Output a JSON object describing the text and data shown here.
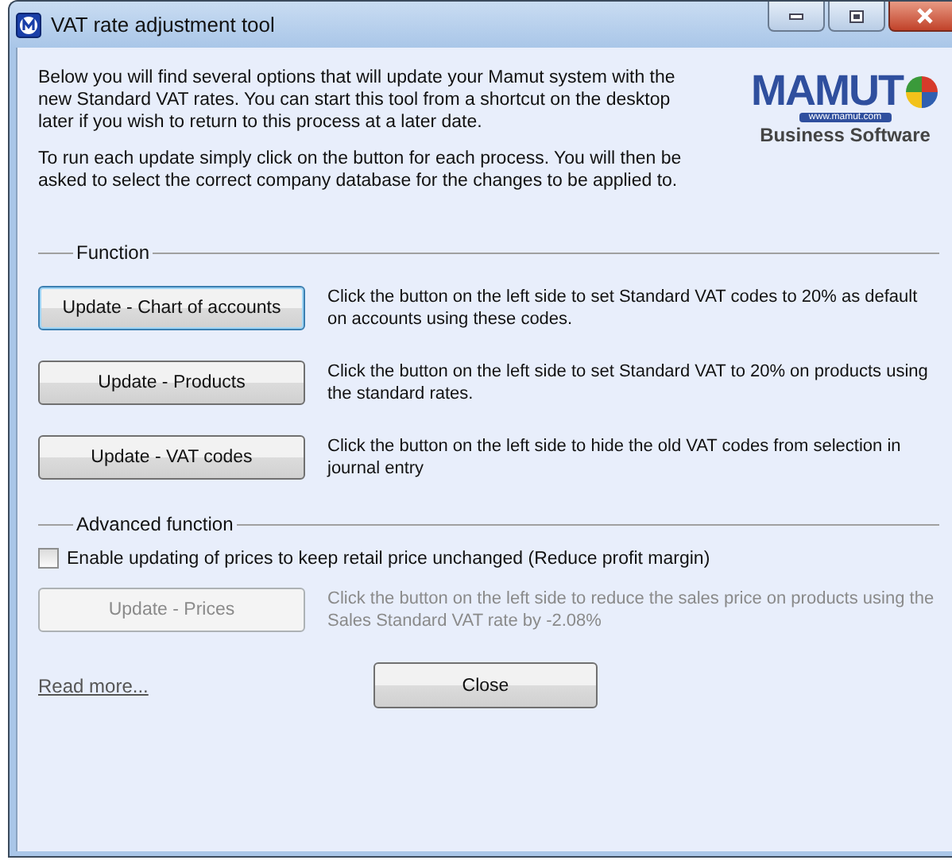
{
  "window": {
    "title": "VAT rate adjustment tool"
  },
  "logo": {
    "wordmark": "MAMUT",
    "url": "www.mamut.com",
    "tagline": "Business Software"
  },
  "intro": [
    "Below you will find several options that will update your Mamut system with the new Standard VAT rates. You can start this tool from a shortcut on the desktop later if you wish to return to this process at a later date.",
    "To run each update simply click on the button for each process. You will then be asked to select the correct company database for the changes to be applied to."
  ],
  "function": {
    "legend": "Function",
    "rows": [
      {
        "button": "Update - Chart of accounts",
        "focused": true,
        "disabled": false,
        "description": "Click the button on the left side to set Standard  VAT codes to 20% as default on accounts using these codes."
      },
      {
        "button": "Update - Products",
        "focused": false,
        "disabled": false,
        "description": "Click the button on the left side to set Standard  VAT to 20% on products using the standard rates."
      },
      {
        "button": "Update - VAT codes",
        "focused": false,
        "disabled": false,
        "description": "Click the button on the left side to hide the old VAT codes from selection in journal entry"
      }
    ]
  },
  "advanced": {
    "legend": "Advanced function",
    "checkbox": {
      "label": "Enable updating of prices to keep retail price unchanged (Reduce profit margin)",
      "checked": false
    },
    "rows": [
      {
        "button": "Update - Prices",
        "focused": false,
        "disabled": true,
        "description": "Click the button on the left side to reduce the sales price on products using the Sales Standard VAT rate by -2.08%"
      }
    ]
  },
  "footer": {
    "link": "Read more...",
    "close": "Close"
  }
}
